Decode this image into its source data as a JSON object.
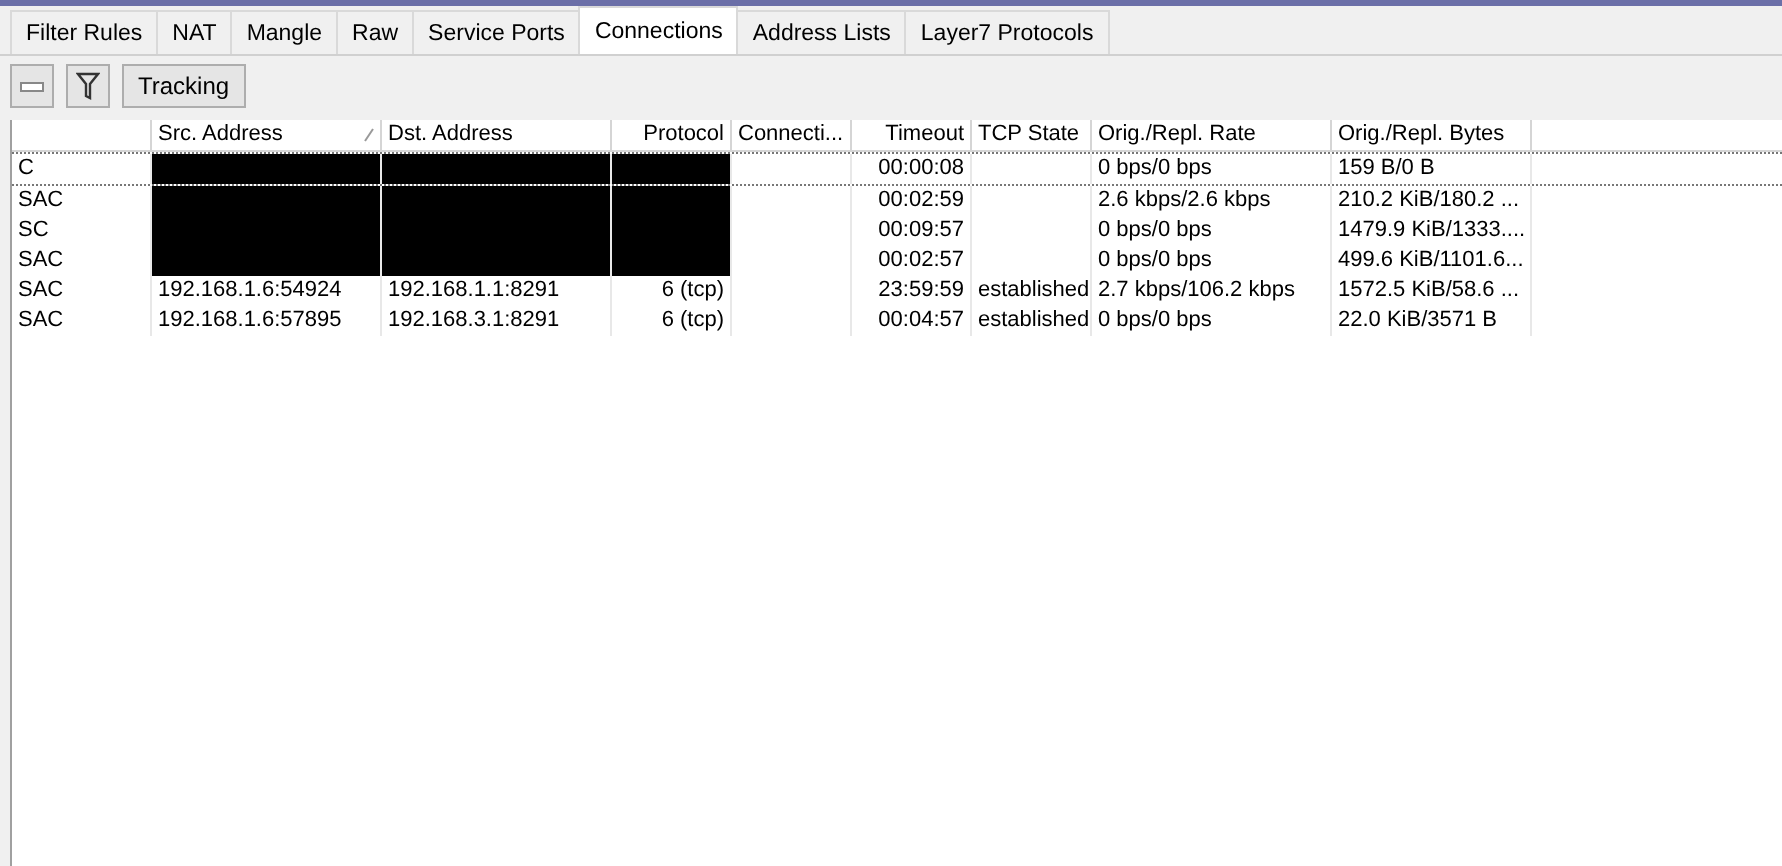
{
  "tabs": [
    {
      "label": "Filter Rules",
      "selected": false
    },
    {
      "label": "NAT",
      "selected": false
    },
    {
      "label": "Mangle",
      "selected": false
    },
    {
      "label": "Raw",
      "selected": false
    },
    {
      "label": "Service Ports",
      "selected": false
    },
    {
      "label": "Connections",
      "selected": true
    },
    {
      "label": "Address Lists",
      "selected": false
    },
    {
      "label": "Layer7 Protocols",
      "selected": false
    }
  ],
  "toolbar": {
    "tracking_button": "Tracking"
  },
  "table": {
    "columns": [
      {
        "sorted": false
      },
      {
        "label": "Src. Address",
        "sorted": true
      },
      {
        "label": "Dst. Address",
        "sorted": false
      },
      {
        "label": "Protocol",
        "sorted": false
      },
      {
        "label": "Connecti...",
        "sorted": false
      },
      {
        "label": "Timeout",
        "sorted": false
      },
      {
        "label": "TCP State",
        "sorted": false
      },
      {
        "label": "Orig./Repl. Rate",
        "sorted": false
      },
      {
        "label": "Orig./Repl. Bytes",
        "sorted": false
      }
    ],
    "rows": [
      {
        "redacted": true,
        "cells": [
          "C",
          "",
          "",
          "",
          "",
          "00:00:08",
          "",
          "0 bps/0 bps",
          "159 B/0 B"
        ]
      },
      {
        "redacted": true,
        "cells": [
          "SAC",
          "",
          "",
          "",
          "",
          "00:02:59",
          "",
          "2.6 kbps/2.6 kbps",
          "210.2 KiB/180.2 ..."
        ]
      },
      {
        "redacted": true,
        "cells": [
          "SC",
          "",
          "",
          "",
          "",
          "00:09:57",
          "",
          "0 bps/0 bps",
          "1479.9 KiB/1333...."
        ]
      },
      {
        "redacted": true,
        "cells": [
          "SAC",
          "",
          "",
          "",
          "",
          "00:02:57",
          "",
          "0 bps/0 bps",
          "499.6 KiB/1101.6..."
        ]
      },
      {
        "redacted": false,
        "cells": [
          "SAC",
          "192.168.1.6:54924",
          "192.168.1.1:8291",
          "6 (tcp)",
          "",
          "23:59:59",
          "established",
          "2.7 kbps/106.2 kbps",
          "1572.5 KiB/58.6 ..."
        ]
      },
      {
        "redacted": false,
        "cells": [
          "SAC",
          "192.168.1.6:57895",
          "192.168.3.1:8291",
          "6 (tcp)",
          "",
          "00:04:57",
          "established",
          "0 bps/0 bps",
          "22.0 KiB/3571 B"
        ]
      }
    ]
  }
}
